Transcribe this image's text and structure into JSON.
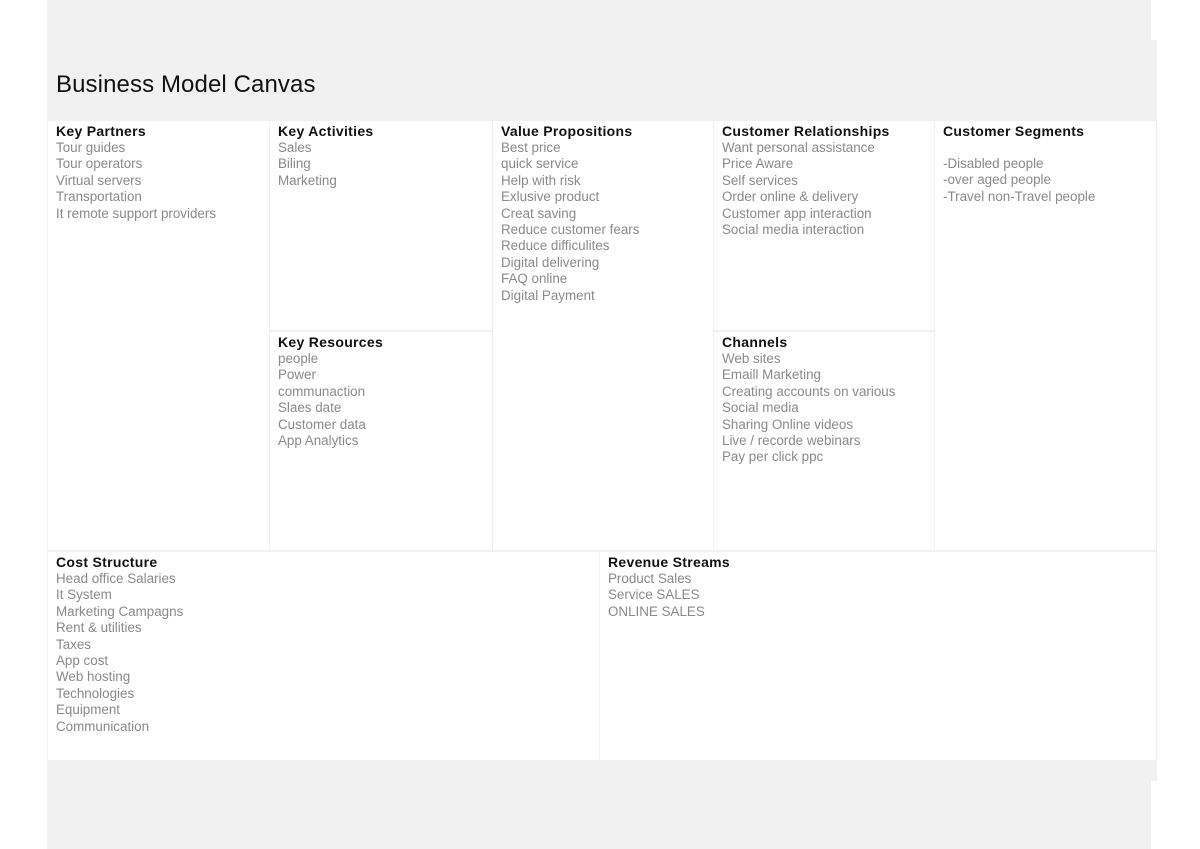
{
  "title": "Business Model Canvas",
  "blocks": {
    "key_partners": {
      "heading": "Key Partners",
      "items": [
        "Tour guides",
        "Tour operators",
        "Virtual servers",
        "Transportation",
        "It remote support providers"
      ]
    },
    "key_activities": {
      "heading": "Key Activities",
      "items": [
        "Sales",
        "Biling",
        "Marketing"
      ]
    },
    "key_resources": {
      "heading": "Key Resources",
      "items": [
        "people",
        "Power",
        "communaction",
        "Slaes date",
        "Customer data",
        "App Analytics"
      ]
    },
    "value_propositions": {
      "heading": "Value Propositions",
      "items": [
        "Best price",
        "quick service",
        "Help with risk",
        "Exlusive product",
        "Creat saving",
        "Reduce customer fears",
        "Reduce difficulites",
        "Digital delivering",
        "FAQ online",
        "Digital Payment"
      ]
    },
    "customer_relationships": {
      "heading": "Customer Relationships",
      "items": [
        "Want personal assistance",
        "Price Aware",
        "Self services",
        "Order online & delivery",
        "Customer app interaction",
        "Social media interaction"
      ]
    },
    "channels": {
      "heading": "Channels",
      "items": [
        "Web sites",
        "Emaill Marketing",
        "Creating accounts on various",
        "Social media",
        "Sharing Online videos",
        "Live / recorde webinars",
        "Pay per click ppc"
      ]
    },
    "customer_segments": {
      "heading": "Customer Segments",
      "items": [
        "-Disabled people",
        "-over aged people",
        "-Travel non-Travel people"
      ]
    },
    "cost_structure": {
      "heading": "Cost Structure",
      "items": [
        "Head office Salaries",
        "It System",
        "Marketing Campagns",
        "Rent & utilities",
        "Taxes",
        "App cost",
        "Web hosting",
        "Technologies",
        "Equipment",
        "Communication"
      ]
    },
    "revenue_streams": {
      "heading": "Revenue Streams",
      "items": [
        "Product Sales",
        "Service SALES",
        "ONLINE SALES"
      ]
    }
  }
}
